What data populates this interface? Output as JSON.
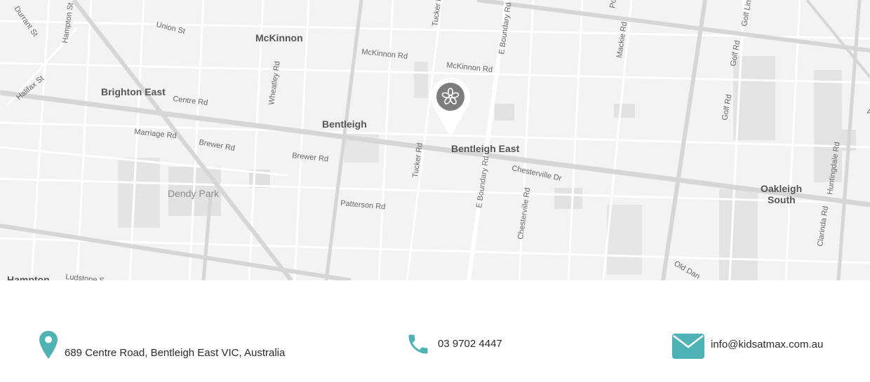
{
  "map": {
    "labels": {
      "durrant_st": "Durrant St",
      "hampton_st": "Hampton St",
      "union_st": "Union St",
      "mckinnon": "McKinnon",
      "mckinnon_rd_1": "McKinnon Rd",
      "mckinnon_rd_2": "McKinnon Rd",
      "tucker_rd_top": "Tucker R",
      "e_boundary_rd_top": "E Boundary Rd",
      "mackie_rd": "Mackie Rd",
      "golf_links": "Golf Lin",
      "golf_rd_1": "Golf Rd",
      "golf_rd_2": "Golf Rd",
      "halifax_st": "Halifax St",
      "brighton_east": "Brighton East",
      "centre_rd": "Centre Rd",
      "wheatley_rd": "Wheatley Rd",
      "bentleigh": "Bentleigh",
      "marriage_rd": "Marriage Rd",
      "brewer_rd_1": "Brewer Rd",
      "brewer_rd_2": "Brewer Rd",
      "tucker_rd": "Tucker Rd",
      "bentleigh_east": "Bentleigh East",
      "chesterville_dr": "Chesterville Dr",
      "e_boundary_rd": "E Boundary Rd",
      "chesterville_rd": "Chesterville Rd",
      "dendy_park": "Dendy Park",
      "patterson_rd": "Patterson Rd",
      "oakleigh": "Oakleigh",
      "south": "South",
      "huntingdale_rd": "Huntingdale Rd",
      "clarinda_rd": "Clarinda Rd",
      "old_dandenong": "Old Dan",
      "hampton": "Hampton",
      "ludstone": "Ludstone S",
      "po": "Po",
      "v": "V"
    },
    "marker_icon": "flower-icon",
    "colors": {
      "map_bg": "#f3f3f3",
      "road": "#ffffff",
      "major_road": "#d6d6d6",
      "marker": "#7d7d7d",
      "accent": "#4fb3b5"
    }
  },
  "contact": {
    "address": {
      "icon": "map-pin-icon",
      "text": "689 Centre Road, Bentleigh East VIC, Australia"
    },
    "phone": {
      "icon": "phone-icon",
      "text": "03 9702 4447"
    },
    "email": {
      "icon": "envelope-icon",
      "text": "info@kidsatmax.com.au"
    }
  }
}
